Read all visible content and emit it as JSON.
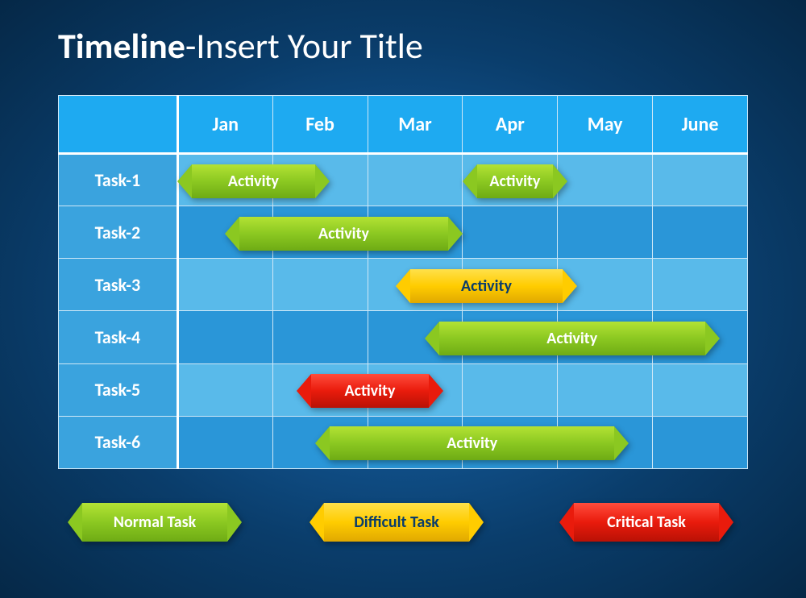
{
  "title_bold": "Timeline",
  "title_rest": "-Insert Your Title",
  "chart_data": {
    "type": "gantt",
    "title": "Timeline-Insert Your Title",
    "categories": [
      "Jan",
      "Feb",
      "Mar",
      "Apr",
      "May",
      "June"
    ],
    "tasks": [
      "Task-1",
      "Task-2",
      "Task-3",
      "Task-4",
      "Task-5",
      "Task-6"
    ],
    "bars": [
      {
        "row": 0,
        "start_col": 0,
        "span": 1.6,
        "label": "Activity",
        "kind": "normal"
      },
      {
        "row": 0,
        "start_col": 3.0,
        "span": 1.1,
        "label": "Activity",
        "kind": "normal"
      },
      {
        "row": 1,
        "start_col": 0.5,
        "span": 2.5,
        "label": "Activity",
        "kind": "normal"
      },
      {
        "row": 2,
        "start_col": 2.3,
        "span": 1.9,
        "label": "Activity",
        "kind": "difficult"
      },
      {
        "row": 3,
        "start_col": 2.6,
        "span": 3.1,
        "label": "Activity",
        "kind": "normal"
      },
      {
        "row": 4,
        "start_col": 1.25,
        "span": 1.55,
        "label": "Activity",
        "kind": "critical"
      },
      {
        "row": 5,
        "start_col": 1.45,
        "span": 3.3,
        "label": "Activity",
        "kind": "normal"
      }
    ],
    "legend": [
      {
        "label": "Normal Task",
        "kind": "normal"
      },
      {
        "label": "Difficult Task",
        "kind": "difficult"
      },
      {
        "label": "Critical Task",
        "kind": "critical"
      }
    ],
    "kind_colors": {
      "normal": "#8bc821",
      "difficult": "#ffcc00",
      "critical": "#e91b0c"
    }
  }
}
